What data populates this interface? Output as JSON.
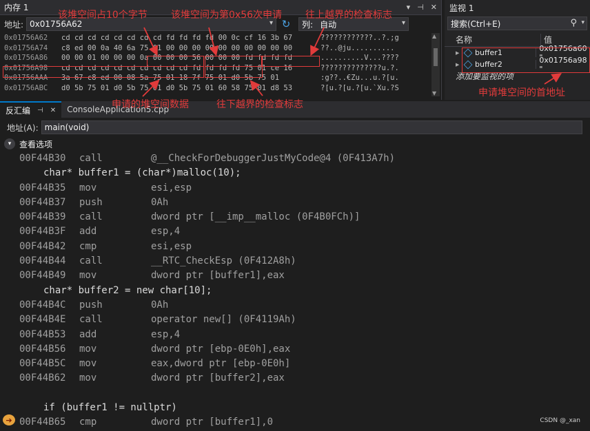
{
  "memory": {
    "title": "内存 1",
    "window_buttons": [
      "▾",
      "⊣",
      "✕"
    ],
    "address_label": "地址:",
    "address_value": "0x01756A62",
    "columns_label": "列:",
    "columns_value": "自动",
    "rows": [
      {
        "addr": "0x01756A62",
        "hex": "cd cd cd cd cd cd cd cd fd fd fd fd 00 0c cf 16 3b 67",
        "ascii": "????????????..?.;g"
      },
      {
        "addr": "0x01756A74",
        "hex": "c8 ed 00 0a 40 6a 75 01 00 00 00 00 00 00 00 00 00 00",
        "ascii": "??..@ju.........."
      },
      {
        "addr": "0x01756A86",
        "hex": "00 00 01 00 00 00 0a 00 00 00 56 00 00 00 fd fd fd fd",
        "ascii": "..........V...????"
      },
      {
        "addr": "0x01756A98",
        "hex": "cd cd cd cd cd cd cd cd cd cd fd fd fd fd 75 01 ce 16",
        "ascii": "??????????????u.?."
      },
      {
        "addr": "0x01756AAA",
        "hex": "3a 67 c8 ed 00 08 5a 75 01 18 7f 75 01 d0 5b 75 01",
        "ascii": ":g??..€Zu...u.?[u."
      },
      {
        "addr": "0x01756ABC",
        "hex": "d0 5b 75 01 d0 5b 75 01 d0 5b 75 01 60 58 75 01 d8 53",
        "ascii": "?[u.?[u.?[u.`Xu.?S"
      }
    ]
  },
  "watch": {
    "title": "监视 1",
    "search_placeholder": "搜索(Ctrl+E)",
    "col_name": "名称",
    "col_value": "值",
    "items": [
      {
        "name": "buffer1",
        "value": "0x01756a60 \""
      },
      {
        "name": "buffer2",
        "value": "0x01756a98 \""
      }
    ],
    "add_item": "添加要监视的项"
  },
  "disasm": {
    "tab_label": "反汇编",
    "tab2_label": "ConsoleApplication5.cpp",
    "address_label": "地址(A):",
    "address_value": "main(void)",
    "view_options": "查看选项",
    "lines": [
      {
        "type": "asm",
        "addr": "00F44B30",
        "mn": "call",
        "op": "@__CheckForDebuggerJustMyCode@4 (0F413A7h)"
      },
      {
        "type": "src",
        "text": "char* buffer1 = (char*)malloc(10);"
      },
      {
        "type": "asm",
        "addr": "00F44B35",
        "mn": "mov",
        "op": "esi,esp"
      },
      {
        "type": "asm",
        "addr": "00F44B37",
        "mn": "push",
        "op": "0Ah"
      },
      {
        "type": "asm",
        "addr": "00F44B39",
        "mn": "call",
        "op": "dword ptr [__imp__malloc (0F4B0FCh)]"
      },
      {
        "type": "asm",
        "addr": "00F44B3F",
        "mn": "add",
        "op": "esp,4"
      },
      {
        "type": "asm",
        "addr": "00F44B42",
        "mn": "cmp",
        "op": "esi,esp"
      },
      {
        "type": "asm",
        "addr": "00F44B44",
        "mn": "call",
        "op": "__RTC_CheckEsp (0F412A8h)"
      },
      {
        "type": "asm",
        "addr": "00F44B49",
        "mn": "mov",
        "op": "dword ptr [buffer1],eax"
      },
      {
        "type": "src",
        "text": "char* buffer2 = new char[10];"
      },
      {
        "type": "asm",
        "addr": "00F44B4C",
        "mn": "push",
        "op": "0Ah"
      },
      {
        "type": "asm",
        "addr": "00F44B4E",
        "mn": "call",
        "op": "operator new[] (0F4119Ah)"
      },
      {
        "type": "asm",
        "addr": "00F44B53",
        "mn": "add",
        "op": "esp,4"
      },
      {
        "type": "asm",
        "addr": "00F44B56",
        "mn": "mov",
        "op": "dword ptr [ebp-0E0h],eax"
      },
      {
        "type": "asm",
        "addr": "00F44B5C",
        "mn": "mov",
        "op": "eax,dword ptr [ebp-0E0h]"
      },
      {
        "type": "asm",
        "addr": "00F44B62",
        "mn": "mov",
        "op": "dword ptr [buffer2],eax"
      },
      {
        "type": "blank"
      },
      {
        "type": "src",
        "text": "if (buffer1 != nullptr)"
      },
      {
        "type": "asm",
        "addr": "00F44B65",
        "mn": "cmp",
        "op": "dword ptr [buffer1],0"
      }
    ]
  },
  "annotations": {
    "a1": "该堆空间占10个字节",
    "a2": "该堆空间为第0x56次申请",
    "a3": "往上越界的检查标志",
    "a4": "申请的堆空间数据",
    "a5": "往下越界的检查标志",
    "a6": "申请堆空间的首地址",
    "color": "#e23b3b"
  },
  "watermark": "CSDN @_xan"
}
